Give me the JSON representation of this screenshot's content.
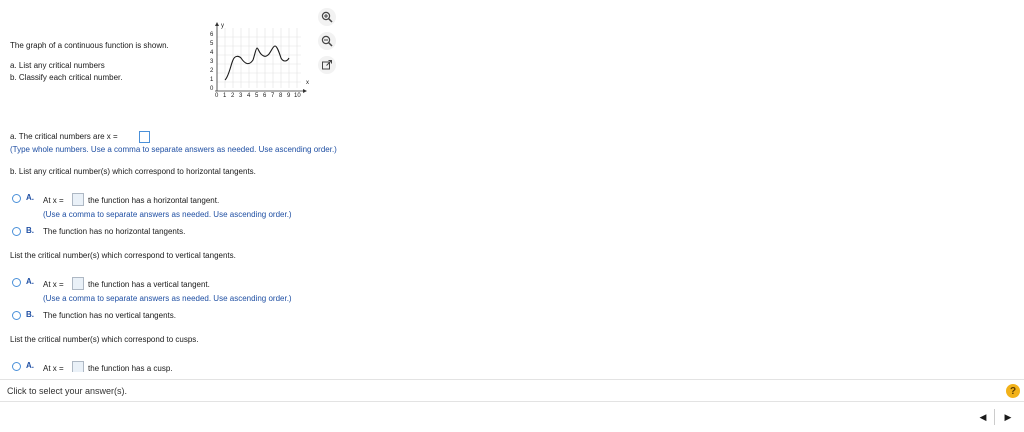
{
  "question": {
    "intro": "The graph of a continuous function is shown.",
    "part_a": "a. List any critical numbers",
    "part_b": "b. Classify each critical number."
  },
  "graph": {
    "x_ticks": [
      "0",
      "1",
      "2",
      "3",
      "4",
      "5",
      "6",
      "7",
      "8",
      "9",
      "10"
    ],
    "y_ticks": [
      "0",
      "1",
      "2",
      "3",
      "4",
      "5",
      "6"
    ],
    "y_axis_label": "y",
    "x_axis_label": "x"
  },
  "tools": {
    "zoom_in_icon": "zoom-in-icon",
    "zoom_out_icon": "zoom-out-icon",
    "popout_icon": "popout-icon"
  },
  "answer_a": {
    "prompt": "a. The critical numbers are x =",
    "hint": "(Type whole numbers. Use a comma to separate answers as needed. Use ascending order.)"
  },
  "horizontal": {
    "prompt": "b. List any critical number(s) which correspond to horizontal tangents.",
    "option_a": {
      "letter": "A.",
      "pre": "At  x =",
      "post": "the function has a horizontal tangent.",
      "hint": "(Use a comma to separate answers as needed. Use ascending order.)"
    },
    "option_b": {
      "letter": "B.",
      "text": "The function has no horizontal tangents."
    }
  },
  "vertical": {
    "prompt": "List the critical number(s) which correspond to vertical tangents.",
    "option_a": {
      "letter": "A.",
      "pre": "At  x =",
      "post": "the function has a vertical tangent.",
      "hint": "(Use a comma to separate answers as needed. Use ascending order.)"
    },
    "option_b": {
      "letter": "B.",
      "text": "The function has no vertical tangents."
    }
  },
  "cusps": {
    "prompt": "List the critical number(s) which correspond to cusps.",
    "option_a": {
      "letter": "A.",
      "pre": "At  x =",
      "post": "the function has a cusp."
    }
  },
  "footer": {
    "status": "Click to select your answer(s).",
    "help": "?",
    "prev": "◀",
    "next": "▶"
  },
  "colors": {
    "link_blue": "#1f4fa3",
    "radio_border": "#4a90d9",
    "help_yellow": "#f2b21a"
  }
}
